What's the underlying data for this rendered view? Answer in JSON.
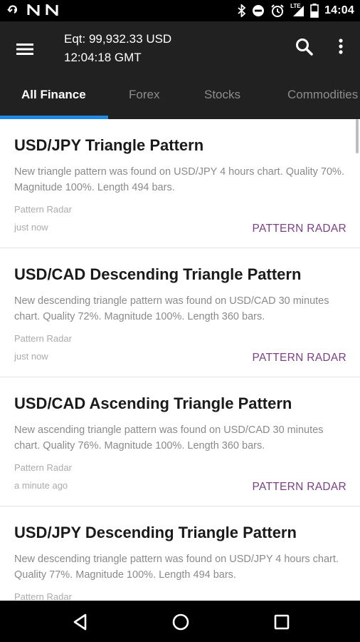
{
  "status_bar": {
    "time": "14:04",
    "network_label": "LTE",
    "left_icons": [
      "vpn-key-icon",
      "n-notification-icon",
      "n-notification-icon"
    ],
    "right_icons": [
      "bluetooth-icon",
      "do-not-disturb-icon",
      "alarm-icon",
      "signal-icon",
      "battery-icon"
    ]
  },
  "app_bar": {
    "equity": "Eqt: 99,932.33 USD",
    "clock": "12:04:18 GMT",
    "menu_icon": "hamburger-menu-icon",
    "search_icon": "search-icon",
    "more_icon": "more-vert-icon"
  },
  "tabs": [
    {
      "label": "All Finance",
      "active": true
    },
    {
      "label": "Forex",
      "active": false
    },
    {
      "label": "Stocks",
      "active": false
    },
    {
      "label": "Commodities",
      "active": false
    }
  ],
  "colors": {
    "accent": "#1e88e5",
    "tag": "#7b3f86",
    "appbar": "#212121"
  },
  "feed": [
    {
      "title": "USD/JPY Triangle Pattern",
      "body": "New triangle pattern was found on USD/JPY 4 hours chart. Quality 70%. Magnitude 100%. Length 494 bars.",
      "source": "Pattern Radar",
      "time": "just now",
      "tag": "PATTERN RADAR"
    },
    {
      "title": "USD/CAD Descending Triangle Pattern",
      "body": "New descending triangle pattern was found on USD/CAD 30 minutes chart. Quality 72%. Magnitude 100%. Length 360 bars.",
      "source": "Pattern Radar",
      "time": "just now",
      "tag": "PATTERN RADAR"
    },
    {
      "title": "USD/CAD Ascending Triangle Pattern",
      "body": "New ascending triangle pattern was found on USD/CAD 30 minutes chart. Quality 76%. Magnitude 100%. Length 360 bars.",
      "source": "Pattern Radar",
      "time": "a minute ago",
      "tag": "PATTERN RADAR"
    },
    {
      "title": "USD/JPY Descending Triangle Pattern",
      "body": "New descending triangle pattern was found on USD/JPY 4 hours chart. Quality 77%. Magnitude 100%. Length 494 bars.",
      "source": "Pattern Radar",
      "time": "",
      "tag": ""
    }
  ],
  "nav_bar": {
    "icons": [
      "back-icon",
      "home-icon",
      "recents-icon"
    ]
  }
}
